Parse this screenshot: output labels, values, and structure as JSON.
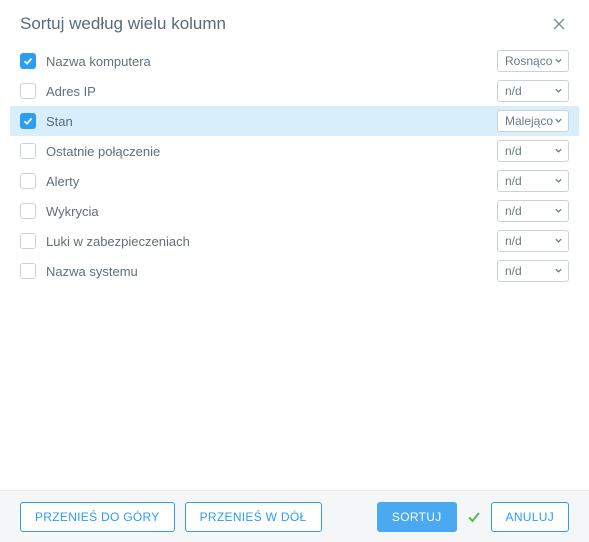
{
  "title": "Sortuj według wielu kolumn",
  "rows": [
    {
      "label": "Nazwa komputera",
      "checked": true,
      "order": "Rosnąco",
      "selected": false
    },
    {
      "label": "Adres IP",
      "checked": false,
      "order": "n/d",
      "selected": false
    },
    {
      "label": "Stan",
      "checked": true,
      "order": "Malejąco",
      "selected": true
    },
    {
      "label": "Ostatnie połączenie",
      "checked": false,
      "order": "n/d",
      "selected": false
    },
    {
      "label": "Alerty",
      "checked": false,
      "order": "n/d",
      "selected": false
    },
    {
      "label": "Wykrycia",
      "checked": false,
      "order": "n/d",
      "selected": false
    },
    {
      "label": "Luki w zabezpieczeniach",
      "checked": false,
      "order": "n/d",
      "selected": false
    },
    {
      "label": "Nazwa systemu",
      "checked": false,
      "order": "n/d",
      "selected": false
    }
  ],
  "footer": {
    "move_up": "PRZENIEŚ DO GÓRY",
    "move_down": "PRZENIEŚ W DÓŁ",
    "sort": "SORTUJ",
    "cancel": "ANULUJ"
  },
  "colors": {
    "accent": "#2b9df4",
    "row_selected_bg": "#d8eefb",
    "success": "#5bb85b"
  }
}
